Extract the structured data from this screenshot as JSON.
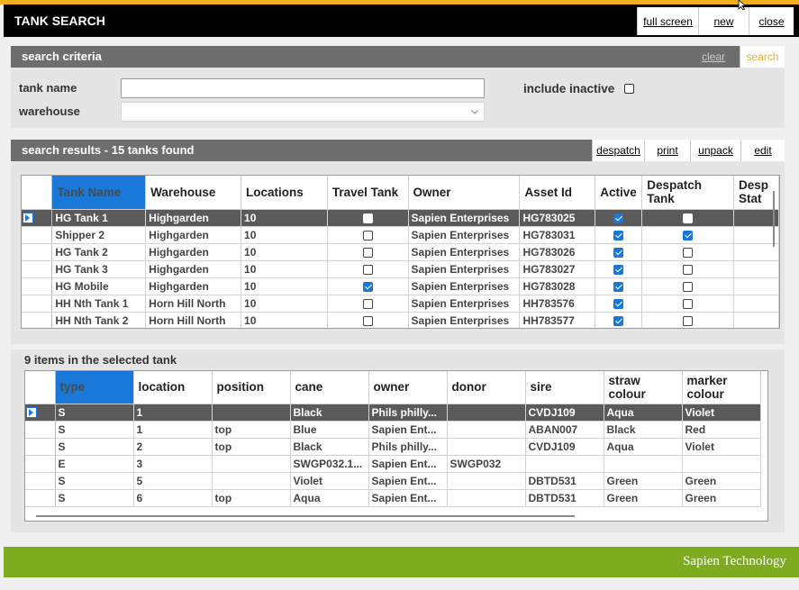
{
  "window": {
    "title": "TANK SEARCH",
    "buttons": {
      "full_screen": "full screen",
      "new": "new",
      "close": "close"
    }
  },
  "criteria": {
    "header": "search criteria",
    "clear": "clear",
    "search": "search",
    "tank_name_label": "tank name",
    "tank_name_value": "",
    "warehouse_label": "warehouse",
    "warehouse_value": "",
    "include_inactive_label": "include inactive",
    "include_inactive_checked": false
  },
  "results": {
    "header": "search results - 15 tanks found",
    "actions": {
      "despatch": "despatch",
      "print": "print",
      "unpack": "unpack",
      "edit": "edit"
    },
    "columns": [
      "Tank Name",
      "Warehouse",
      "Locations",
      "Travel Tank",
      "Owner",
      "Asset Id",
      "Active",
      "Despatch Tank",
      "Despatch Status"
    ],
    "column_display": [
      "Tank Name",
      "Warehouse",
      "Locations",
      "Travel Tank",
      "Owner",
      "Asset Id",
      "Active",
      "Despatch\nTank",
      "Desp\nStat"
    ],
    "rows": [
      {
        "name": "HG Tank 1",
        "warehouse": "Highgarden",
        "locations": "10",
        "travel": false,
        "owner": "Sapien Enterprises",
        "asset": "HG783025",
        "active": true,
        "despatch": false,
        "selected": true
      },
      {
        "name": "Shipper 2",
        "warehouse": "Highgarden",
        "locations": "10",
        "travel": false,
        "owner": "Sapien Enterprises",
        "asset": "HG783031",
        "active": true,
        "despatch": true,
        "selected": false
      },
      {
        "name": "HG Tank 2",
        "warehouse": "Highgarden",
        "locations": "10",
        "travel": false,
        "owner": "Sapien Enterprises",
        "asset": "HG783026",
        "active": true,
        "despatch": false,
        "selected": false
      },
      {
        "name": "HG Tank 3",
        "warehouse": "Highgarden",
        "locations": "10",
        "travel": false,
        "owner": "Sapien Enterprises",
        "asset": "HG783027",
        "active": true,
        "despatch": false,
        "selected": false
      },
      {
        "name": "HG Mobile",
        "warehouse": "Highgarden",
        "locations": "10",
        "travel": true,
        "owner": "Sapien Enterprises",
        "asset": "HG783028",
        "active": true,
        "despatch": false,
        "selected": false
      },
      {
        "name": "HH Nth Tank 1",
        "warehouse": "Horn Hill North",
        "locations": "10",
        "travel": false,
        "owner": "Sapien Enterprises",
        "asset": "HH783576",
        "active": true,
        "despatch": false,
        "selected": false
      },
      {
        "name": "HH Nth Tank 2",
        "warehouse": "Horn Hill North",
        "locations": "10",
        "travel": false,
        "owner": "Sapien Enterprises",
        "asset": "HH783577",
        "active": true,
        "despatch": false,
        "selected": false
      }
    ]
  },
  "items": {
    "header": "9 items in the selected tank",
    "columns": [
      "type",
      "location",
      "position",
      "cane",
      "owner",
      "donor",
      "sire",
      "straw colour",
      "marker colour"
    ],
    "column_display": [
      "type",
      "location",
      "position",
      "cane",
      "owner",
      "donor",
      "sire",
      "straw\ncolour",
      "marker\ncolour"
    ],
    "rows": [
      {
        "type": "S",
        "location": "1",
        "position": "",
        "cane": "Black",
        "owner": "Phils philly...",
        "donor": "",
        "sire": "CVDJ109",
        "straw": "Aqua",
        "marker": "Violet",
        "selected": true
      },
      {
        "type": "S",
        "location": "1",
        "position": "top",
        "cane": "Blue",
        "owner": "Sapien Ent...",
        "donor": "",
        "sire": "ABAN007",
        "straw": "Black",
        "marker": "Red",
        "selected": false
      },
      {
        "type": "S",
        "location": "2",
        "position": "top",
        "cane": "Black",
        "owner": "Phils philly...",
        "donor": "",
        "sire": "CVDJ109",
        "straw": "Aqua",
        "marker": "Violet",
        "selected": false
      },
      {
        "type": "E",
        "location": "3",
        "position": "",
        "cane": "SWGP032.1...",
        "owner": "Sapien Ent...",
        "donor": "SWGP032",
        "sire": "",
        "straw": "",
        "marker": "",
        "selected": false
      },
      {
        "type": "S",
        "location": "5",
        "position": "",
        "cane": "Violet",
        "owner": "Sapien Ent...",
        "donor": "",
        "sire": "DBTD531",
        "straw": "Green",
        "marker": "Green",
        "selected": false
      },
      {
        "type": "S",
        "location": "6",
        "position": "top",
        "cane": "Aqua",
        "owner": "Sapien Ent...",
        "donor": "",
        "sire": "DBTD531",
        "straw": "Green",
        "marker": "Green",
        "selected": false
      }
    ]
  },
  "footer": {
    "brand": "Sapien Technology"
  },
  "colors": {
    "accent_yellow": "#f2b01e",
    "footer_green": "#7eac1f",
    "selection_blue": "#1a78d8",
    "header_gray": "#6e6e6e"
  }
}
